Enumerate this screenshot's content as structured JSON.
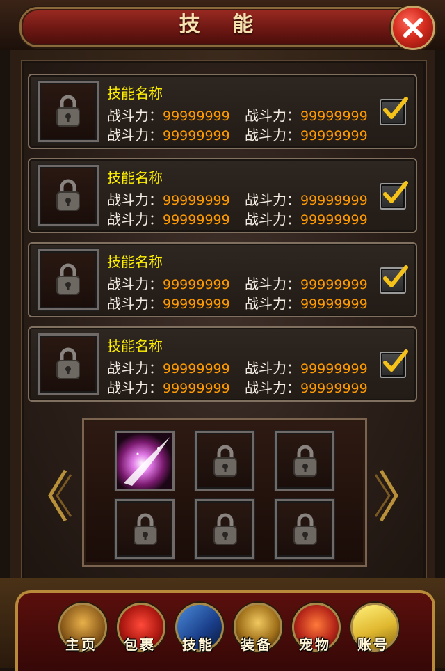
{
  "header": {
    "title": "技 能"
  },
  "skills": [
    {
      "name": "技能名称",
      "stat_label": "战斗力：",
      "stats": [
        "99999999",
        "99999999",
        "99999999",
        "99999999"
      ],
      "checked": true
    },
    {
      "name": "技能名称",
      "stat_label": "战斗力：",
      "stats": [
        "99999999",
        "99999999",
        "99999999",
        "99999999"
      ],
      "checked": true
    },
    {
      "name": "技能名称",
      "stat_label": "战斗力：",
      "stats": [
        "99999999",
        "99999999",
        "99999999",
        "99999999"
      ],
      "checked": true
    },
    {
      "name": "技能名称",
      "stat_label": "战斗力：",
      "stats": [
        "99999999",
        "99999999",
        "99999999",
        "99999999"
      ],
      "checked": true
    }
  ],
  "grid": {
    "slots": [
      "skill-effect",
      "locked",
      "locked",
      "locked",
      "locked",
      "locked"
    ]
  },
  "nav": {
    "items": [
      {
        "label": "主页",
        "icon": "warrior-icon"
      },
      {
        "label": "包裹",
        "icon": "bag-icon"
      },
      {
        "label": "技能",
        "icon": "skill-book-icon"
      },
      {
        "label": "装备",
        "icon": "armor-icon"
      },
      {
        "label": "宠物",
        "icon": "dragon-icon"
      },
      {
        "label": "账号",
        "icon": "scroll-icon"
      }
    ]
  },
  "colors": {
    "skill_name": "#fff000",
    "stat_value": "#ff9a00",
    "accent": "#b88a3a"
  }
}
